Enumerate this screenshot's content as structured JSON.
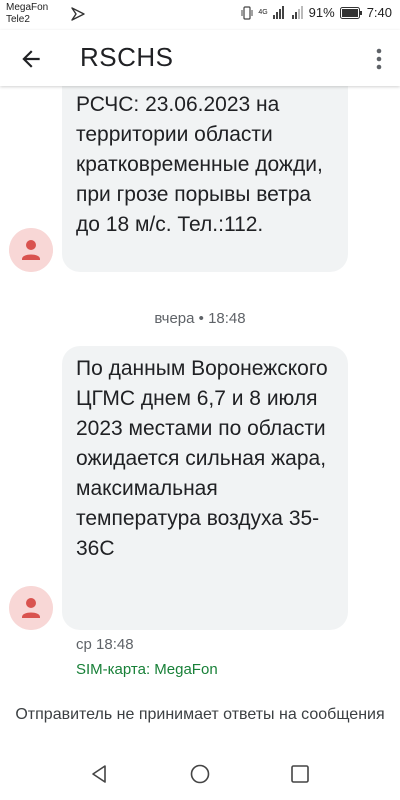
{
  "status_bar": {
    "carrier1": "MegaFon",
    "carrier2": "Tele2",
    "network": "4G",
    "battery": "91%",
    "time": "7:40"
  },
  "app_bar": {
    "title": "RSCHS",
    "icons": [
      "back-arrow-icon",
      "more-vert-icon"
    ]
  },
  "messages": [
    {
      "text": "РСЧС: 23.06.2023 на территории области кратковременные дожди, при грозе порывы ветра до 18 м/с. Тел.:112."
    },
    {
      "date_separator": "вчера • 18:48",
      "text": "По данным Воронежского ЦГМС днем 6,7 и 8 июля 2023 местами по области ожидается сильная жара, максимальная температура воздуха 35-36С",
      "time": "ср 18:48",
      "sim": "SIM-карта: MegaFon"
    }
  ],
  "footer_note": "Отправитель не принимает ответы на сообщения",
  "nav_bar": {
    "icons": [
      "back-triangle-icon",
      "home-circle-icon",
      "recents-square-icon"
    ]
  },
  "colors": {
    "bubble": "#f1f3f4",
    "avatar_bg": "#f8d7d6",
    "avatar_fg": "#d9534f",
    "sim_green": "#188038"
  }
}
